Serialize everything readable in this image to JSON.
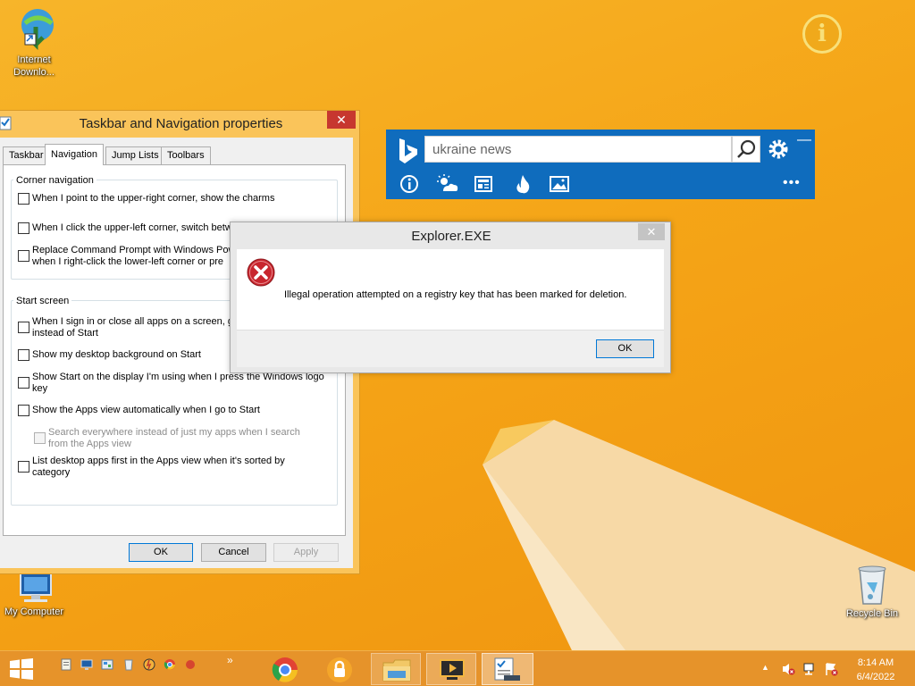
{
  "desktop": {
    "icons": {
      "idm": "Internet Downlo...",
      "my_computer": "My Computer",
      "recycle_bin": "Recycle Bin"
    },
    "info_badge": "i"
  },
  "bing_bar": {
    "search_value": "ukraine news",
    "more_label": "•••"
  },
  "props_window": {
    "title": "Taskbar and Navigation properties",
    "tabs": [
      "Taskbar",
      "Navigation",
      "Jump Lists",
      "Toolbars"
    ],
    "active_tab": "Navigation",
    "corner_group": {
      "legend": "Corner navigation",
      "options": [
        "When I point to the upper-right corner, show the charms",
        "When I click the upper-left corner, switch betw",
        "Replace Command Prompt with Windows Pow",
        "when I right-click the lower-left corner or pre"
      ]
    },
    "start_group": {
      "legend": "Start screen",
      "options": [
        "When I sign in or close all apps on a screen, g",
        "instead of Start",
        "Show my desktop background on Start",
        "Show Start on the display I'm using when I press the Windows logo",
        "key",
        "Show the Apps view automatically when I go to Start",
        "Search everywhere instead of just my apps when I search",
        "from the Apps view",
        "List desktop apps first in the Apps view when it's sorted by",
        "category"
      ]
    },
    "buttons": {
      "ok": "OK",
      "cancel": "Cancel",
      "apply": "Apply"
    },
    "close_glyph": "✕"
  },
  "error_dialog": {
    "title": "Explorer.EXE",
    "message": "Illegal operation attempted on a registry key that has been marked for deletion.",
    "ok_label": "OK",
    "close_glyph": "✕"
  },
  "taskbar": {
    "overflow_glyph": "»",
    "tray_arrow": "▲",
    "time": "8:14 AM",
    "date": "6/4/2022"
  },
  "colors": {
    "wallpaper": "#f5a517",
    "bing_blue": "#0f6cbd",
    "close_red": "#c7372f",
    "error_red": "#c8262e"
  }
}
